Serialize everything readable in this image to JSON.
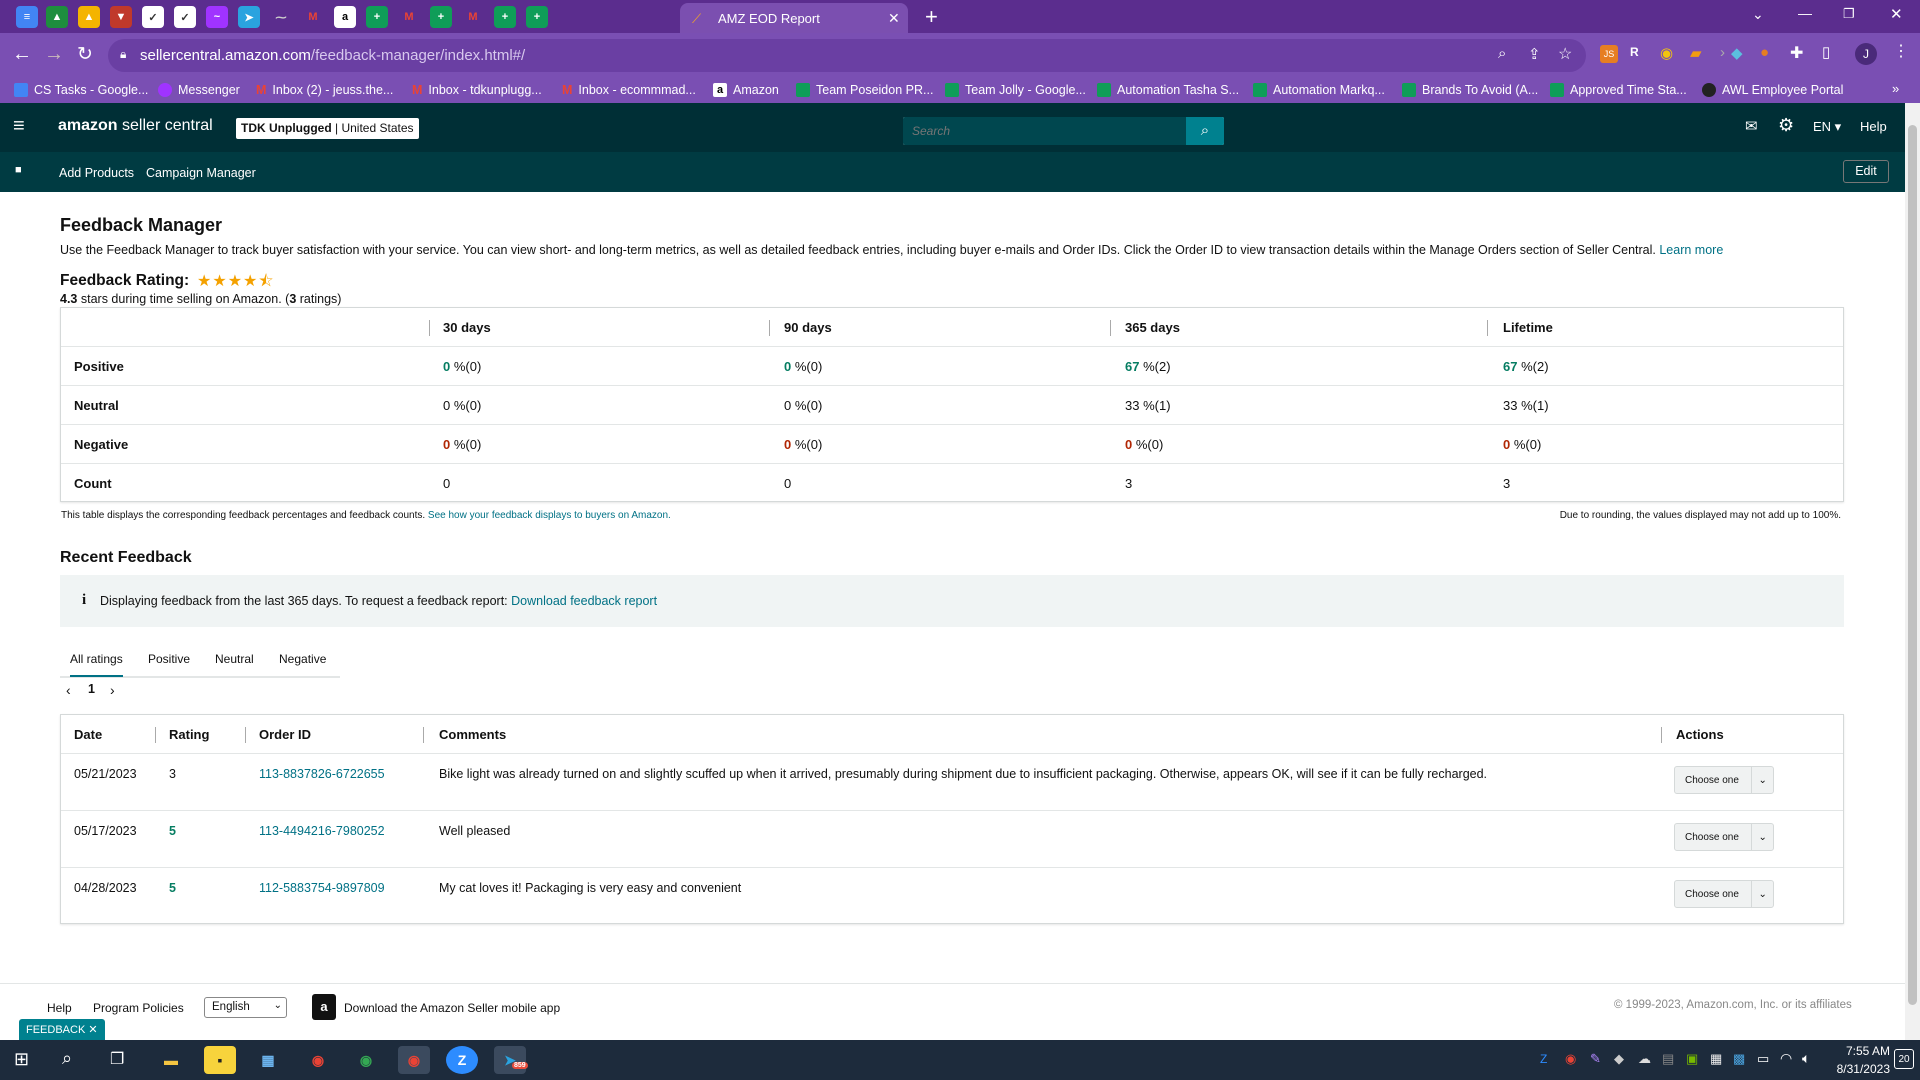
{
  "browser": {
    "active_tab_title": "AMZ EOD Report",
    "url_host": "sellercentral.amazon.com",
    "url_path": "/feedback-manager/index.html#/",
    "bookmarks": [
      "CS Tasks - Google...",
      "Messenger",
      "Inbox (2) - jeuss.the...",
      "Inbox - tdkunplugg...",
      "Inbox - ecommmad...",
      "Amazon",
      "Team Poseidon PR...",
      "Team Jolly - Google...",
      "Automation Tasha S...",
      "Automation Markq...",
      "Brands To Avoid (A...",
      "Approved Time Sta...",
      "AWL Employee Portal"
    ],
    "profile_initial": "J"
  },
  "header": {
    "logo_amazon": "amazon",
    "logo_sc": "seller central",
    "store_name": "TDK Unplugged",
    "store_region": "United States",
    "search_placeholder": "Search",
    "lang": "EN",
    "help": "Help"
  },
  "nav": {
    "items": [
      "Add Products",
      "Campaign Manager"
    ],
    "edit": "Edit"
  },
  "feedback_manager": {
    "title": "Feedback Manager",
    "description": "Use the Feedback Manager to track buyer satisfaction with your service. You can view short- and long-term metrics, as well as detailed feedback entries, including buyer e-mails and Order IDs. Click the Order ID to view transaction details within the Manage Orders section of Seller Central.",
    "learn_more": "Learn more",
    "rating_label": "Feedback Rating:",
    "stars": 4.3,
    "rating_value": "4.3",
    "rating_text_1": "stars during time selling on Amazon. (",
    "rating_count": "3",
    "rating_text_2": "ratings)",
    "columns": [
      "30 days",
      "90 days",
      "365 days",
      "Lifetime"
    ],
    "rows": [
      {
        "label": "Positive",
        "values": [
          [
            "0",
            "%(0)"
          ],
          [
            "0",
            "%(0)"
          ],
          [
            "67",
            "%(2)"
          ],
          [
            "67",
            "%(2)"
          ]
        ],
        "color": "green"
      },
      {
        "label": "Neutral",
        "values": [
          [
            "0",
            "%(0)"
          ],
          [
            "0",
            "%(0)"
          ],
          [
            "33",
            "%(1)"
          ],
          [
            "33",
            "%(1)"
          ]
        ],
        "color": "none"
      },
      {
        "label": "Negative",
        "values": [
          [
            "0",
            "%(0)"
          ],
          [
            "0",
            "%(0)"
          ],
          [
            "0",
            "%(0)"
          ],
          [
            "0",
            "%(0)"
          ]
        ],
        "color": "red"
      },
      {
        "label": "Count",
        "values": [
          [
            "0",
            ""
          ],
          [
            "0",
            ""
          ],
          [
            "3",
            ""
          ],
          [
            "3",
            ""
          ]
        ],
        "color": "none"
      }
    ],
    "note_left": "This table displays the corresponding feedback percentages and feedback counts.",
    "note_link": "See how your feedback displays to buyers on Amazon.",
    "note_right": "Due to rounding, the values displayed may not add up to 100%."
  },
  "recent": {
    "title": "Recent Feedback",
    "info_text": "Displaying feedback from the last 365 days. To request a feedback report:",
    "info_link": "Download feedback report",
    "tabs": [
      "All ratings",
      "Positive",
      "Neutral",
      "Negative"
    ],
    "page": "1",
    "columns": [
      "Date",
      "Rating",
      "Order ID",
      "Comments",
      "Actions"
    ],
    "rows": [
      {
        "date": "05/21/2023",
        "rating": "3",
        "order_id": "113-8837826-6722655",
        "comment": "Bike light was already turned on and slightly scuffed up when it arrived, presumably during shipment due to insufficient packaging. Otherwise, appears OK, will see if it can be fully recharged.",
        "action": "Choose one"
      },
      {
        "date": "05/17/2023",
        "rating": "5",
        "order_id": "113-4494216-7980252",
        "comment": "Well pleased",
        "action": "Choose one"
      },
      {
        "date": "04/28/2023",
        "rating": "5",
        "order_id": "112-5883754-9897809",
        "comment": "My cat loves it! Packaging is very easy and convenient",
        "action": "Choose one"
      }
    ]
  },
  "footer": {
    "help": "Help",
    "policies": "Program Policies",
    "language": "English",
    "app_text": "Download the Amazon Seller mobile app",
    "copyright": "© 1999-2023, Amazon.com, Inc. or its affiliates",
    "feedback_tab": "FEEDBACK"
  },
  "taskbar": {
    "time": "7:55 AM",
    "date": "8/31/2023",
    "notif_count": "20",
    "badge": "859"
  },
  "colors": {
    "tabstrip": "#5b2d8e",
    "toolbar": "#7a4fb3",
    "sc_header": "#002f36",
    "search_btn": "#00818f",
    "link": "#007185",
    "positive": "#067d62",
    "negative": "#b12704"
  }
}
